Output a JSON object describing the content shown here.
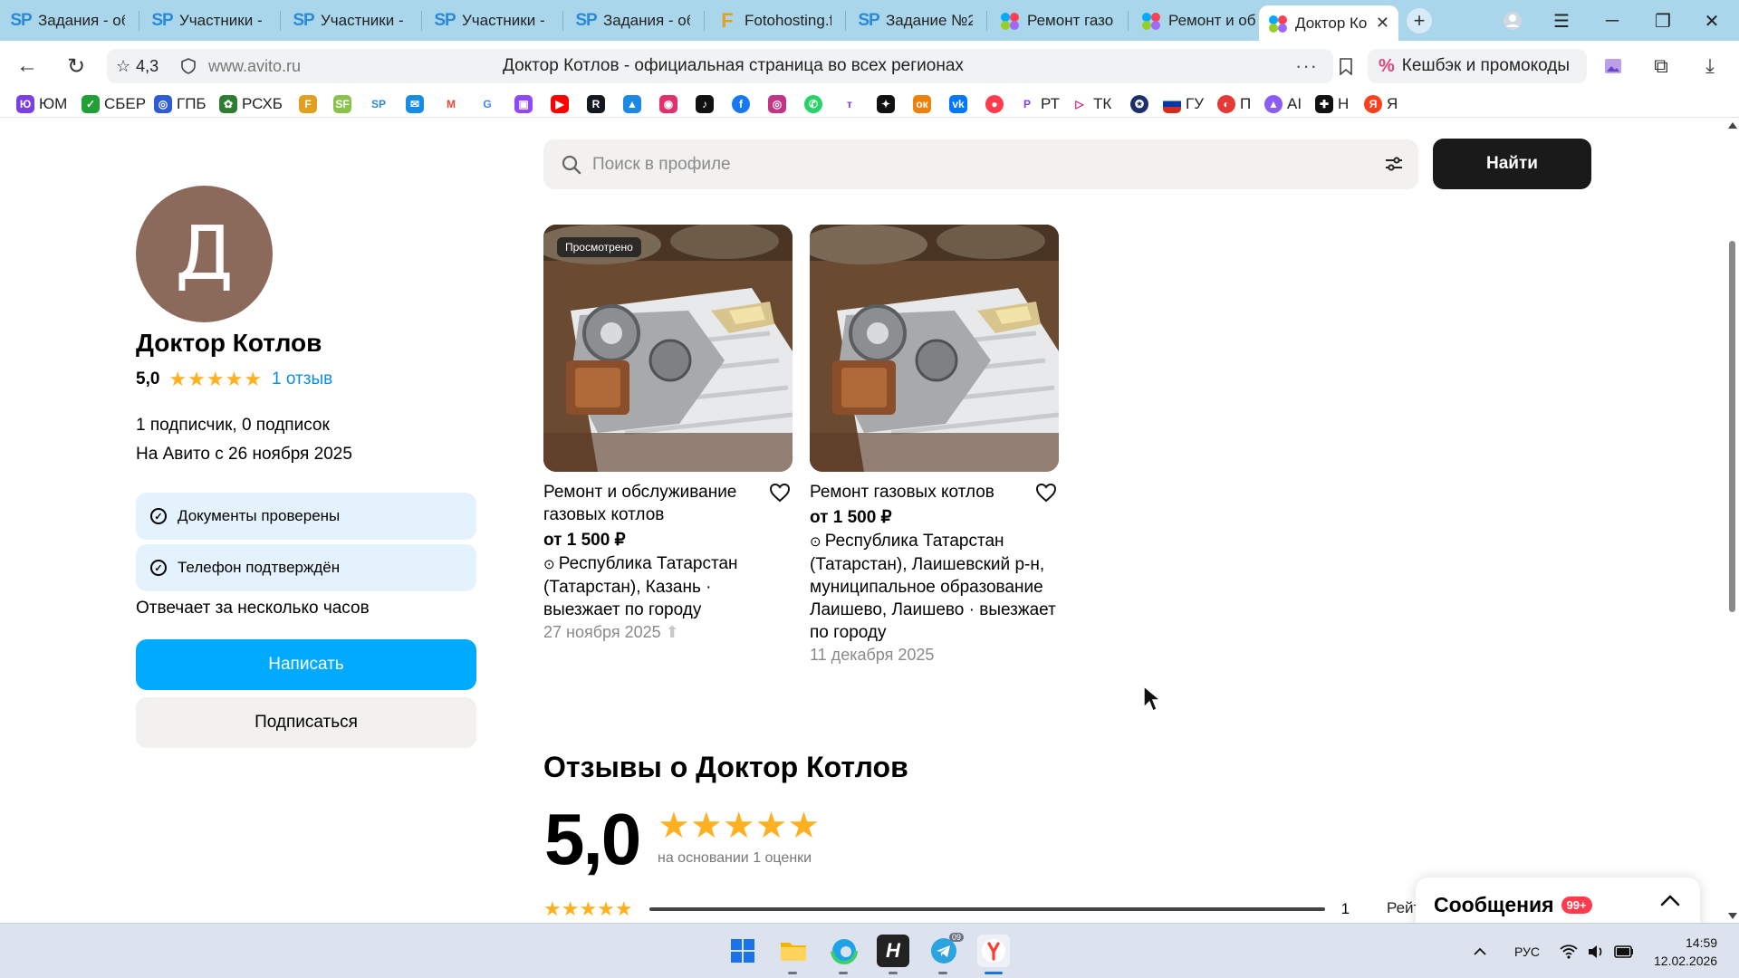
{
  "browser": {
    "tabs": [
      {
        "icon": "sp-icon",
        "label": "Задания - об"
      },
      {
        "icon": "sp-icon",
        "label": "Участники - г"
      },
      {
        "icon": "sp-icon",
        "label": "Участники - г"
      },
      {
        "icon": "sp-icon",
        "label": "Участники - г"
      },
      {
        "icon": "sp-icon",
        "label": "Задания - об"
      },
      {
        "icon": "fotohosting-icon",
        "label": "Fotohosting.f"
      },
      {
        "icon": "sp-icon",
        "label": "Задание №2("
      },
      {
        "icon": "avito-icon",
        "label": "Ремонт газо"
      },
      {
        "icon": "avito-icon",
        "label": "Ремонт и обс"
      },
      {
        "icon": "avito-icon",
        "label": "Доктор Ко"
      }
    ],
    "rating": "4,3",
    "url_host": "www.avito.ru",
    "page_title": "Доктор Котлов - официальная страница во всех регионах",
    "cashback_label": "Кешбэк и промокоды",
    "bookmarks": [
      "ЮМ",
      "СБЕР",
      "ГПБ",
      "РСХБ",
      "РТ",
      "ТК",
      "ГУ",
      "П",
      "AI",
      "Н",
      "Я"
    ]
  },
  "profile": {
    "avatar_letter": "Д",
    "name": "Доктор Котлов",
    "rating": "5,0",
    "stars": "★★★★★",
    "reviews_link": "1 отзыв",
    "subscribers": "1 подписчик, 0 подписок",
    "since": "На Авито с 26 ноября 2025",
    "badges": [
      "Документы проверены",
      "Телефон подтверждён"
    ],
    "response_time": "Отвечает за несколько часов",
    "write_button": "Написать",
    "subscribe_button": "Подписаться"
  },
  "search": {
    "placeholder": "Поиск в профиле",
    "button": "Найти"
  },
  "listings": [
    {
      "viewed_badge": "Просмотрено",
      "title": "Ремонт и обслуживание газовых котлов",
      "price": "от 1 500 ₽",
      "location": "Республика Татарстан (Татарстан), Казань · выезжает по городу",
      "date": "27 ноября 2025"
    },
    {
      "title": "Ремонт газовых котлов",
      "price": "от 1 500 ₽",
      "location": "Республика Татарстан (Татарстан), Лаишевский р-н, муниципальное образование Лаишево, Лаишево · выезжает по городу",
      "date": "11 декабря 2025"
    }
  ],
  "reviews": {
    "heading": "Отзывы о Доктор Котлов",
    "score": "5,0",
    "stars": "★★★★★",
    "based_on": "на основании 1 оценки",
    "five_star_count": "1",
    "five_star_share": 1.0,
    "rating_label_cut": "Рейт"
  },
  "messages": {
    "label": "Сообщения",
    "count": "99+"
  },
  "taskbar": {
    "lang": "РУС",
    "time": "14:59",
    "date": "12.02.2026",
    "telegram_badge": "09"
  },
  "colors": {
    "tabstrip": "#a9d6ea",
    "avito_blue": "#00aaff",
    "star": "#ffb021",
    "avatar": "#8b6a5c"
  }
}
